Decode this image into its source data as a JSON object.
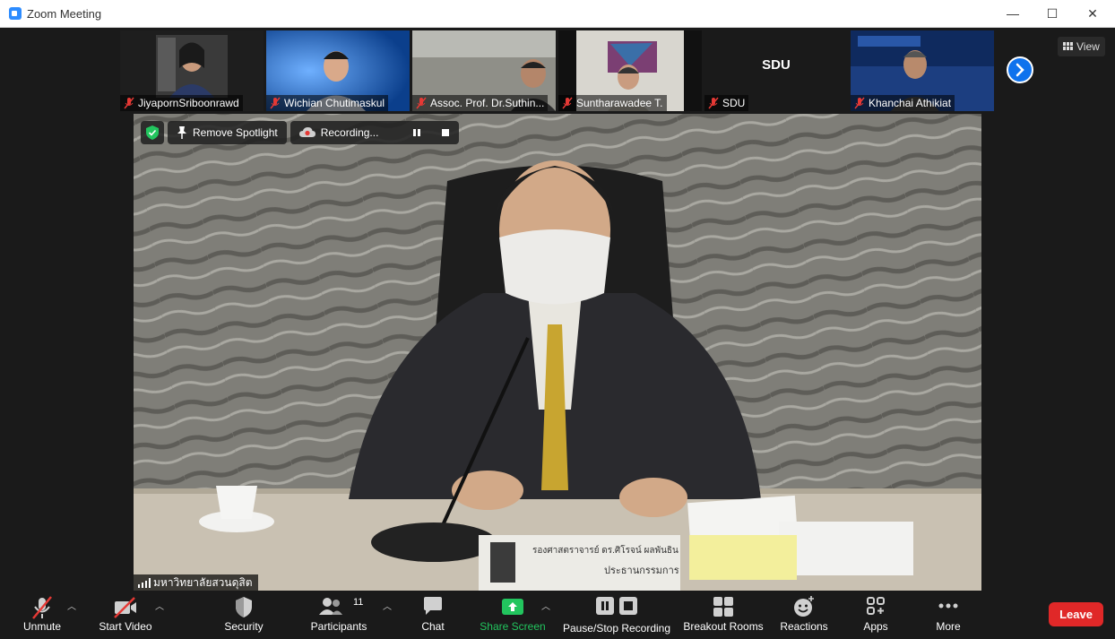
{
  "window": {
    "title": "Zoom Meeting",
    "controls": {
      "minimize": "—",
      "maximize": "☐",
      "close": "✕"
    }
  },
  "thumbnails": [
    {
      "name": "JiyapornSriboonrawd",
      "muted": true
    },
    {
      "name": "Wichian Chutimaskul",
      "muted": true
    },
    {
      "name": "Assoc. Prof. Dr.Suthin...",
      "muted": true
    },
    {
      "name": "Suntharawadee T.",
      "muted": true
    },
    {
      "name": "SDU",
      "muted": true,
      "name_only_display": "SDU"
    },
    {
      "name": "Khanchai Athikiat",
      "muted": true
    }
  ],
  "view_button": "View",
  "spotlight_bar": {
    "remove_spotlight": "Remove Spotlight",
    "recording": "Recording..."
  },
  "main_video": {
    "venue_label": "มหาวิทยาลัยสวนดุสิต",
    "nameplate_line1": "รองศาสตราจารย์ ดร.ศิโรจน์ ผลพันธิน",
    "nameplate_line2": "ประธานกรรมการ"
  },
  "toolbar": {
    "unmute": "Unmute",
    "start_video": "Start Video",
    "security": "Security",
    "participants": "Participants",
    "participants_count": "11",
    "chat": "Chat",
    "share_screen": "Share Screen",
    "pause_stop_recording": "Pause/Stop Recording",
    "breakout_rooms": "Breakout Rooms",
    "reactions": "Reactions",
    "apps": "Apps",
    "more": "More",
    "leave": "Leave"
  },
  "colors": {
    "accent_blue": "#0e72ed",
    "share_green": "#22c55e",
    "leave_red": "#e02828",
    "mute_red": "#e53935"
  }
}
